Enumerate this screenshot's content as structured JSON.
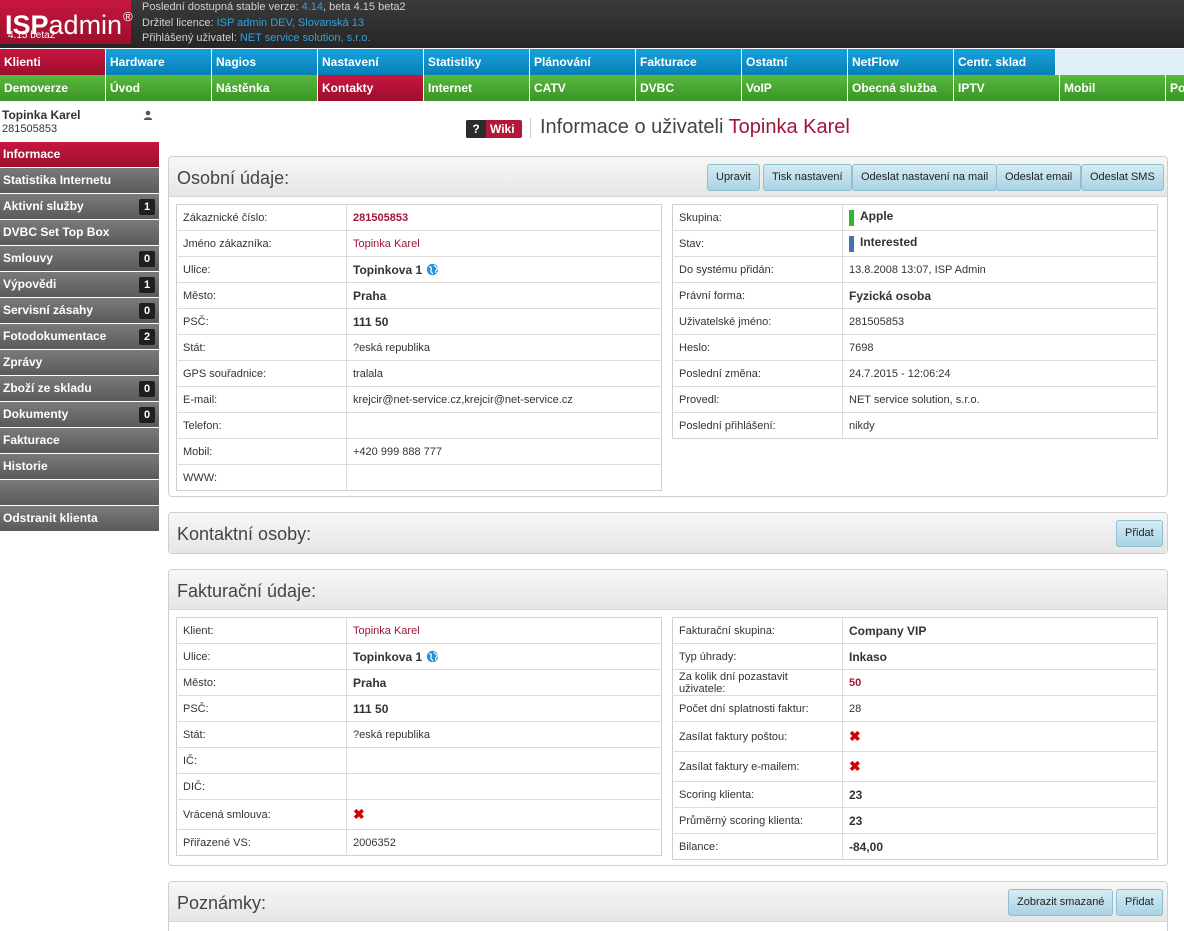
{
  "app": {
    "logo_bold": "ISP",
    "logo_light": "admin",
    "logo_reg": "®",
    "version": "4.15 beta2"
  },
  "topinfo": {
    "line1_label": "Poslední dostupná stable verze:",
    "line1_stable": "4.14",
    "line1_mid": ", beta",
    "line1_beta": "4.15 beta2",
    "line2_label": "Držitel licence:",
    "line2_value": "ISP admin DEV, Slovanská 13",
    "line3_label": "Přihlášený uživatel:",
    "line3_value": "NET service solution, s.r.o."
  },
  "nav1": [
    "Klienti",
    "Hardware",
    "Nagios",
    "Nastavení",
    "Statistiky",
    "Plánování",
    "Fakturace",
    "Ostatní",
    "NetFlow",
    "Centr. sklad"
  ],
  "nav2": [
    "Demoverze",
    "Úvod",
    "Nástěnka",
    "Kontakty",
    "Internet",
    "CATV",
    "DVBC",
    "VoIP",
    "Obecná služba",
    "IPTV",
    "Mobil",
    "Po"
  ],
  "sidebar": {
    "user_name": "Topinka Karel",
    "user_id": "281505853",
    "items": [
      {
        "label": "Informace",
        "badge": ""
      },
      {
        "label": "Statistika Internetu",
        "badge": ""
      },
      {
        "label": "Aktivní služby",
        "badge": "1"
      },
      {
        "label": "DVBC Set Top Box",
        "badge": ""
      },
      {
        "label": "Smlouvy",
        "badge": "0"
      },
      {
        "label": "Výpovědi",
        "badge": "1"
      },
      {
        "label": "Servisní zásahy",
        "badge": "0"
      },
      {
        "label": "Fotodokumentace",
        "badge": "2"
      },
      {
        "label": "Zprávy",
        "badge": ""
      },
      {
        "label": "Zboží ze skladu",
        "badge": "0"
      },
      {
        "label": "Dokumenty",
        "badge": "0"
      },
      {
        "label": "Fakturace",
        "badge": ""
      },
      {
        "label": "Historie",
        "badge": ""
      },
      {
        "label": "",
        "badge": ""
      },
      {
        "label": "Odstranit klienta",
        "badge": ""
      }
    ]
  },
  "page": {
    "wiki_q": "?",
    "wiki_label": "Wiki",
    "title_prefix": "Informace o uživateli",
    "title_name": "Topinka Karel"
  },
  "personal": {
    "title": "Osobní údaje:",
    "buttons": [
      "Upravit",
      "Tisk nastavení",
      "Odeslat nastavení na mail",
      "Odeslat email",
      "Odeslat SMS"
    ],
    "left": [
      {
        "label": "Zákaznické číslo:",
        "value": "281505853",
        "style": "redb"
      },
      {
        "label": "Jméno zákazníka:",
        "value": "Topinka Karel",
        "style": "red"
      },
      {
        "label": "Ulice:",
        "value": "Topinkova 1",
        "style": "bold",
        "globe": true
      },
      {
        "label": "Město:",
        "value": "Praha",
        "style": "bold"
      },
      {
        "label": "PSČ:",
        "value": "111 50",
        "style": "bold"
      },
      {
        "label": "Stát:",
        "value": "?eská republika",
        "style": ""
      },
      {
        "label": "GPS souřadnice:",
        "value": "tralala",
        "style": ""
      },
      {
        "label": "E-mail:",
        "value": "krejcir@net-service.cz,krejcir@net-service.cz",
        "style": ""
      },
      {
        "label": "Telefon:",
        "value": "",
        "style": ""
      },
      {
        "label": "Mobil:",
        "value": "+420 999 888 777",
        "style": ""
      },
      {
        "label": "WWW:",
        "value": "",
        "style": ""
      }
    ],
    "right": [
      {
        "label": "Skupina:",
        "value": "Apple",
        "style": "bold",
        "swatch": "#2fb52f"
      },
      {
        "label": "Stav:",
        "value": "Interested",
        "style": "bold",
        "swatch": "#4a6fb0"
      },
      {
        "label": "Do systému přidán:",
        "value": "13.8.2008 13:07, ISP Admin",
        "style": ""
      },
      {
        "label": "Právní forma:",
        "value": "Fyzická osoba",
        "style": "bold"
      },
      {
        "label": "Uživatelské jméno:",
        "value": "281505853",
        "style": ""
      },
      {
        "label": "Heslo:",
        "value": "7698",
        "style": ""
      },
      {
        "label": "Poslední změna:",
        "value": "24.7.2015 - 12:06:24",
        "style": ""
      },
      {
        "label": "Provedl:",
        "value": "NET service solution, s.r.o.",
        "style": ""
      },
      {
        "label": "Poslední přihlášení:",
        "value": "nikdy",
        "style": ""
      }
    ]
  },
  "contacts": {
    "title": "Kontaktní osoby:",
    "add_label": "Přidat"
  },
  "billing": {
    "title": "Fakturační údaje:",
    "left": [
      {
        "label": "Klient:",
        "value": "Topinka Karel",
        "style": "red"
      },
      {
        "label": "Ulice:",
        "value": "Topinkova 1",
        "style": "bold",
        "globe": true
      },
      {
        "label": "Město:",
        "value": "Praha",
        "style": "bold"
      },
      {
        "label": "PSČ:",
        "value": "111 50",
        "style": "bold"
      },
      {
        "label": "Stát:",
        "value": "?eská republika",
        "style": ""
      },
      {
        "label": "IČ:",
        "value": "",
        "style": ""
      },
      {
        "label": "DIČ:",
        "value": "",
        "style": ""
      },
      {
        "label": "Vrácená smlouva:",
        "value": "✖",
        "style": "x"
      },
      {
        "label": "Přiřazené VS:",
        "value": "2006352",
        "style": ""
      }
    ],
    "right": [
      {
        "label": "Fakturační skupina:",
        "value": "Company VIP",
        "style": "bold"
      },
      {
        "label": "Typ úhrady:",
        "value": "Inkaso",
        "style": "bold"
      },
      {
        "label": "Za kolik dní pozastavit uživatele:",
        "value": "50",
        "style": "redb"
      },
      {
        "label": "Počet dní splatnosti faktur:",
        "value": "28",
        "style": ""
      },
      {
        "label": "Zasílat faktury poštou:",
        "value": "✖",
        "style": "x"
      },
      {
        "label": "Zasílat faktury e-mailem:",
        "value": "✖",
        "style": "x"
      },
      {
        "label": "Scoring klienta:",
        "value": "23",
        "style": "bold"
      },
      {
        "label": "Průměrný scoring klienta:",
        "value": "23",
        "style": "bold"
      },
      {
        "label": "Bilance:",
        "value": "-84,00",
        "style": "bold"
      }
    ]
  },
  "notes": {
    "title": "Poznámky:",
    "show_deleted_label": "Zobrazit smazané",
    "add_label": "Přidat"
  }
}
